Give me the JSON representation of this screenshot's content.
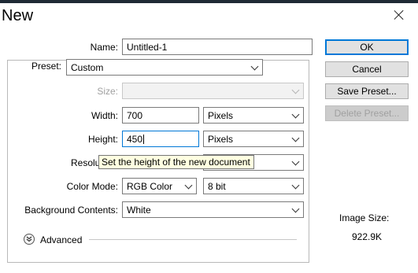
{
  "dialog": {
    "title": "New"
  },
  "name": {
    "label": "Name:",
    "value": "Untitled-1"
  },
  "preset": {
    "group_label": "Preset:",
    "value": "Custom"
  },
  "size": {
    "label": "Size:",
    "value": ""
  },
  "width": {
    "label": "Width:",
    "value": "700",
    "unit": "Pixels"
  },
  "height": {
    "label": "Height:",
    "value": "450",
    "unit": "Pixels"
  },
  "resolution": {
    "label": "Resolu",
    "unit": ""
  },
  "color_mode": {
    "label": "Color Mode:",
    "value": "RGB Color",
    "depth": "8 bit"
  },
  "background": {
    "label": "Background Contents:",
    "value": "White"
  },
  "advanced": {
    "label": "Advanced"
  },
  "buttons": {
    "ok": "OK",
    "cancel": "Cancel",
    "save_preset": "Save Preset...",
    "delete_preset": "Delete Preset..."
  },
  "tooltip": {
    "text": "Set the height of the new document"
  },
  "image_size": {
    "label": "Image Size:",
    "value": "922.9K"
  },
  "colors": {
    "accent": "#0078d7",
    "tooltip_bg": "#ffffe1",
    "disabled_text": "#a0a0a0"
  }
}
